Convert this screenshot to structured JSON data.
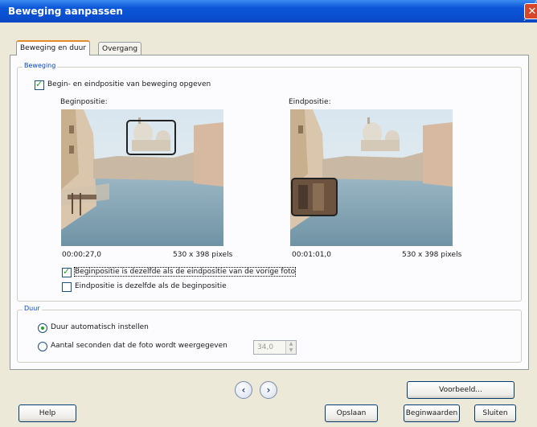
{
  "window": {
    "title": "Beweging aanpassen",
    "close_glyph": "✕"
  },
  "tabs": [
    {
      "label": "Beweging en duur",
      "active": true
    },
    {
      "label": "Overgang",
      "active": false
    }
  ],
  "motion_group": {
    "label": "Beweging",
    "specify_checkbox": {
      "label": "Begin- en eindpositie van beweging opgeven",
      "checked": true
    },
    "start": {
      "label": "Beginpositie:",
      "time": "00:00:27,0",
      "size": "530 x 398 pixels"
    },
    "end": {
      "label": "Eindpositie:",
      "time": "00:01:01,0",
      "size": "530 x 398 pixels"
    },
    "same_as_prev_checkbox": {
      "label": "Beginpositie is dezelfde als de eindpositie van de vorige foto",
      "checked": true
    },
    "end_same_checkbox": {
      "label": "Eindpositie is dezelfde als de beginpositie",
      "checked": false
    }
  },
  "duration_group": {
    "label": "Duur",
    "auto_radio": {
      "label": "Duur automatisch instellen",
      "selected": true
    },
    "seconds_radio": {
      "label": "Aantal seconden dat de foto wordt weergegeven",
      "selected": false
    },
    "seconds_value": "34,0"
  },
  "nav": {
    "prev_glyph": "‹",
    "next_glyph": "›"
  },
  "buttons": {
    "preview": "Voorbeeld...",
    "help": "Help",
    "save": "Opslaan",
    "defaults": "Beginwaarden",
    "close": "Sluiten"
  },
  "colors": {
    "titlebar": "#0a4fd0",
    "accent_label": "#0046d5",
    "check": "#21a121"
  }
}
